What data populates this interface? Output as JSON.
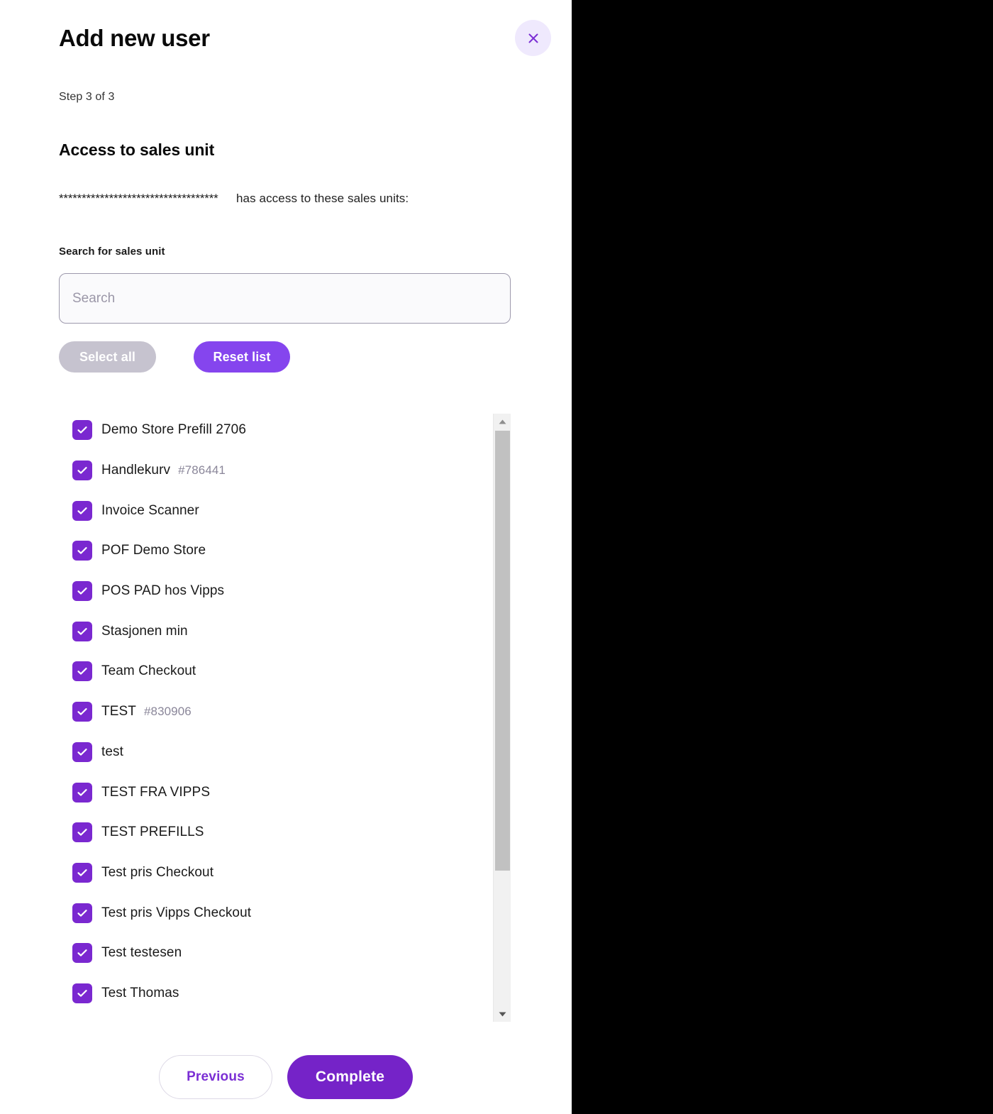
{
  "modal": {
    "title": "Add new user",
    "close_icon": "close-icon",
    "step_label": "Step 3 of 3",
    "section_heading": "Access to sales unit",
    "masked_user_name": "***********************************",
    "access_text": "has access to these sales units:",
    "search": {
      "label": "Search for sales unit",
      "placeholder": "Search",
      "value": ""
    },
    "actions": {
      "select_all_label": "Select all",
      "reset_list_label": "Reset list"
    },
    "sales_units": [
      {
        "name": "Demo Store Prefill 2706",
        "id": "",
        "checked": true
      },
      {
        "name": "Handlekurv",
        "id": "#786441",
        "checked": true
      },
      {
        "name": "Invoice Scanner",
        "id": "",
        "checked": true
      },
      {
        "name": "POF Demo Store",
        "id": "",
        "checked": true
      },
      {
        "name": "POS PAD hos Vipps",
        "id": "",
        "checked": true
      },
      {
        "name": "Stasjonen min",
        "id": "",
        "checked": true
      },
      {
        "name": "Team Checkout",
        "id": "",
        "checked": true
      },
      {
        "name": "TEST",
        "id": "#830906",
        "checked": true
      },
      {
        "name": "test",
        "id": "",
        "checked": true
      },
      {
        "name": "TEST FRA VIPPS",
        "id": "",
        "checked": true
      },
      {
        "name": "TEST PREFILLS",
        "id": "",
        "checked": true
      },
      {
        "name": "Test pris Checkout",
        "id": "",
        "checked": true
      },
      {
        "name": "Test pris Vipps Checkout",
        "id": "",
        "checked": true
      },
      {
        "name": "Test testesen",
        "id": "",
        "checked": true
      },
      {
        "name": "Test Thomas",
        "id": "",
        "checked": true
      }
    ],
    "footer": {
      "previous_label": "Previous",
      "complete_label": "Complete"
    },
    "scrollbar": {
      "up_icon": "chevron-up-icon",
      "down_icon": "chevron-down-icon"
    }
  },
  "colors": {
    "brand_purple": "#7523c8",
    "checkbox_purple": "#7a28d0",
    "reset_purple": "#8545ee",
    "disabled_grey": "#c6c3cf",
    "close_bg": "#efe9fd",
    "id_grey": "#8a8699"
  }
}
